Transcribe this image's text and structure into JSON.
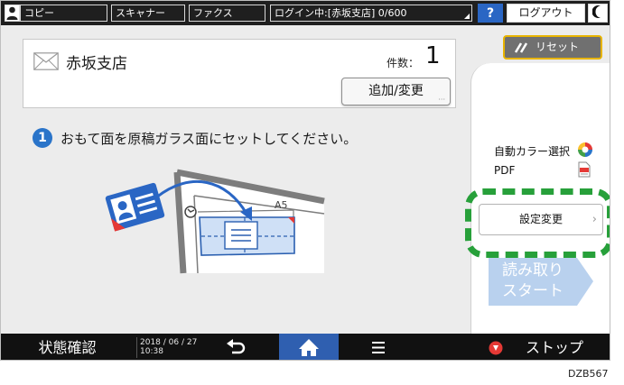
{
  "topbar": {
    "tabs": [
      "コピー",
      "スキャナー",
      "ファクス"
    ],
    "login_status": "ログイン中:[赤坂支店] 0/600",
    "help_label": "?",
    "logout_label": "ログアウト"
  },
  "destination": {
    "name": "赤坂支店",
    "count_label": "件数：",
    "count_value": "1",
    "add_change_label": "追加/変更"
  },
  "instruction": {
    "step": "1",
    "text": "おもて面を原稿ガラス面にセットしてください。",
    "paper_size": "A5"
  },
  "right_panel": {
    "reset_label": "リセット",
    "color_mode": "自動カラー選択",
    "file_format": "PDF",
    "settings_label": "設定変更",
    "start_label": "読み取り スタート"
  },
  "bottombar": {
    "status_label": "状態確認",
    "date": "2018 / 06 / 27",
    "time": "10:38",
    "stop_label": "ストップ"
  },
  "colors": {
    "highlight": "#27a03a",
    "accent_blue": "#2a74c9",
    "start_button": "#b9d1ee",
    "home_button": "#2f5fb0",
    "reset_border": "#e8b400"
  },
  "figure_code": "DZB567"
}
